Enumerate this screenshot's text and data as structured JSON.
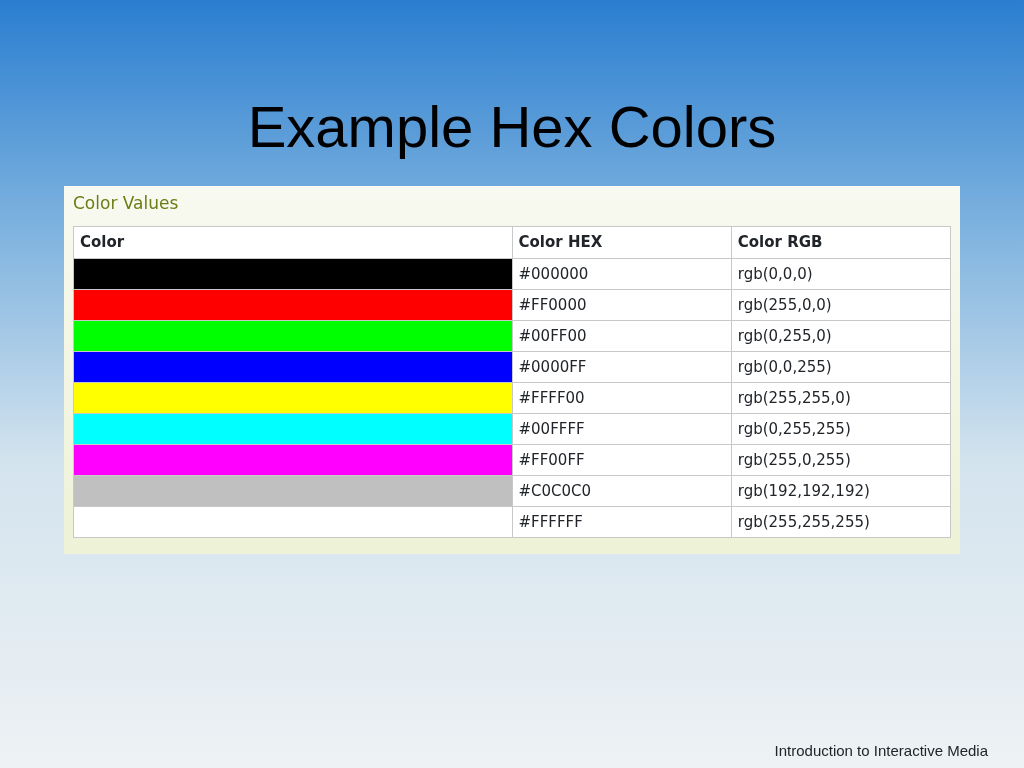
{
  "slide": {
    "title": "Example Hex Colors",
    "footer": "Introduction to Interactive Media"
  },
  "panel": {
    "heading": "Color Values",
    "table": {
      "columns": [
        "Color",
        "Color HEX",
        "Color RGB"
      ],
      "rows": [
        {
          "color": "#000000",
          "hex": "#000000",
          "rgb": "rgb(0,0,0)"
        },
        {
          "color": "#ff0000",
          "hex": "#FF0000",
          "rgb": "rgb(255,0,0)"
        },
        {
          "color": "#00ff00",
          "hex": "#00FF00",
          "rgb": "rgb(0,255,0)"
        },
        {
          "color": "#0000ff",
          "hex": "#0000FF",
          "rgb": "rgb(0,0,255)"
        },
        {
          "color": "#ffff00",
          "hex": "#FFFF00",
          "rgb": "rgb(255,255,0)"
        },
        {
          "color": "#00ffff",
          "hex": "#00FFFF",
          "rgb": "rgb(0,255,255)"
        },
        {
          "color": "#ff00ff",
          "hex": "#FF00FF",
          "rgb": "rgb(255,0,255)"
        },
        {
          "color": "#c0c0c0",
          "hex": "#C0C0C0",
          "rgb": "rgb(192,192,192)"
        },
        {
          "color": "#ffffff",
          "hex": "#FFFFFF",
          "rgb": "rgb(255,255,255)"
        }
      ]
    }
  }
}
